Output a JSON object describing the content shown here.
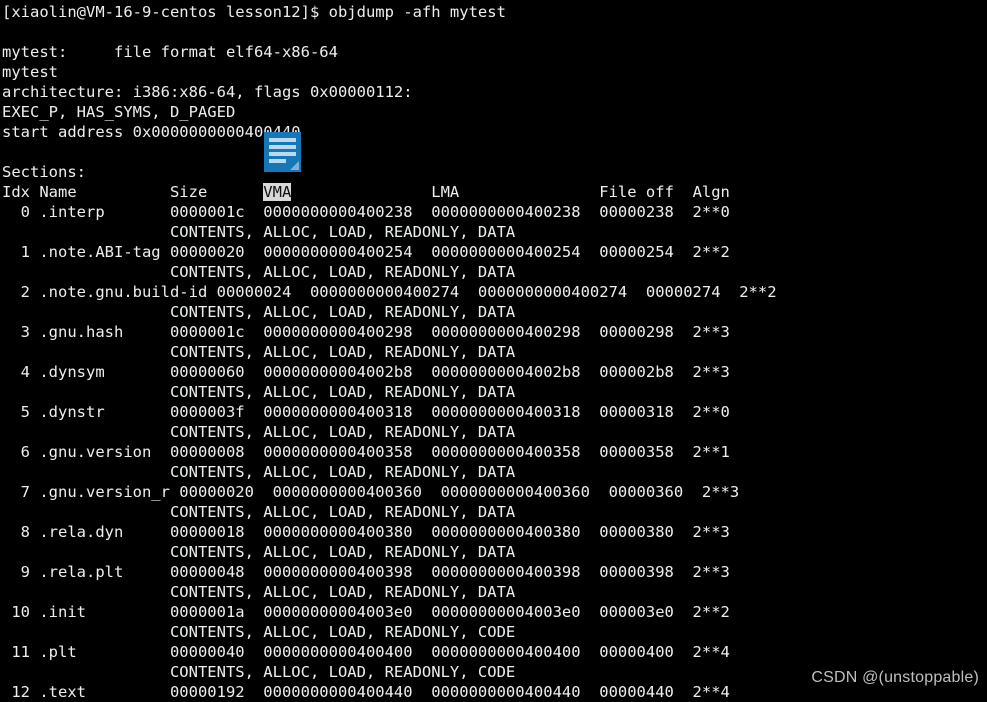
{
  "terminal": {
    "prompt": "[xiaolin@VM-16-9-centos lesson12]$ ",
    "command": "objdump -afh mytest",
    "prompt_line": "[xiaolin@VM-16-9-centos lesson12]$ objdump -afh mytest",
    "header": {
      "file_format_line": "mytest:     file format elf64-x86-64",
      "file_name_line": "mytest",
      "architecture_line": "architecture: i386:x86-64, flags 0x00000112:",
      "flags_line": "EXEC_P, HAS_SYMS, D_PAGED",
      "start_address_line": "start address 0x0000000000400440"
    },
    "sections_label": "Sections:",
    "columns": {
      "idx": "Idx",
      "name": "Name",
      "size": "Size",
      "vma": "VMA",
      "lma": "LMA",
      "file_off": "File off",
      "algn": "Algn",
      "header_line_pre": "Idx Name          Size      ",
      "header_line_sel": "VMA",
      "header_line_post": "               LMA               File off  Algn"
    },
    "sections": [
      {
        "line": "  0 .interp       0000001c  0000000000400238  0000000000400238  00000238  2**0",
        "flags": "                  CONTENTS, ALLOC, LOAD, READONLY, DATA",
        "idx": "0",
        "name": ".interp",
        "size": "0000001c",
        "vma": "0000000000400238",
        "lma": "0000000000400238",
        "file_off": "00000238",
        "algn": "2**0"
      },
      {
        "line": "  1 .note.ABI-tag 00000020  0000000000400254  0000000000400254  00000254  2**2",
        "flags": "                  CONTENTS, ALLOC, LOAD, READONLY, DATA",
        "idx": "1",
        "name": ".note.ABI-tag",
        "size": "00000020",
        "vma": "0000000000400254",
        "lma": "0000000000400254",
        "file_off": "00000254",
        "algn": "2**2"
      },
      {
        "line": "  2 .note.gnu.build-id 00000024  0000000000400274  0000000000400274  00000274  2**2",
        "flags": "                  CONTENTS, ALLOC, LOAD, READONLY, DATA",
        "idx": "2",
        "name": ".note.gnu.build-id",
        "size": "00000024",
        "vma": "0000000000400274",
        "lma": "0000000000400274",
        "file_off": "00000274",
        "algn": "2**2"
      },
      {
        "line": "  3 .gnu.hash     0000001c  0000000000400298  0000000000400298  00000298  2**3",
        "flags": "                  CONTENTS, ALLOC, LOAD, READONLY, DATA",
        "idx": "3",
        "name": ".gnu.hash",
        "size": "0000001c",
        "vma": "0000000000400298",
        "lma": "0000000000400298",
        "file_off": "00000298",
        "algn": "2**3"
      },
      {
        "line": "  4 .dynsym       00000060  00000000004002b8  00000000004002b8  000002b8  2**3",
        "flags": "                  CONTENTS, ALLOC, LOAD, READONLY, DATA",
        "idx": "4",
        "name": ".dynsym",
        "size": "00000060",
        "vma": "00000000004002b8",
        "lma": "00000000004002b8",
        "file_off": "000002b8",
        "algn": "2**3"
      },
      {
        "line": "  5 .dynstr       0000003f  0000000000400318  0000000000400318  00000318  2**0",
        "flags": "                  CONTENTS, ALLOC, LOAD, READONLY, DATA",
        "idx": "5",
        "name": ".dynstr",
        "size": "0000003f",
        "vma": "0000000000400318",
        "lma": "0000000000400318",
        "file_off": "00000318",
        "algn": "2**0"
      },
      {
        "line": "  6 .gnu.version  00000008  0000000000400358  0000000000400358  00000358  2**1",
        "flags": "                  CONTENTS, ALLOC, LOAD, READONLY, DATA",
        "idx": "6",
        "name": ".gnu.version",
        "size": "00000008",
        "vma": "0000000000400358",
        "lma": "0000000000400358",
        "file_off": "00000358",
        "algn": "2**1"
      },
      {
        "line": "  7 .gnu.version_r 00000020  0000000000400360  0000000000400360  00000360  2**3",
        "flags": "                  CONTENTS, ALLOC, LOAD, READONLY, DATA",
        "idx": "7",
        "name": ".gnu.version_r",
        "size": "00000020",
        "vma": "0000000000400360",
        "lma": "0000000000400360",
        "file_off": "00000360",
        "algn": "2**3"
      },
      {
        "line": "  8 .rela.dyn     00000018  0000000000400380  0000000000400380  00000380  2**3",
        "flags": "                  CONTENTS, ALLOC, LOAD, READONLY, DATA",
        "idx": "8",
        "name": ".rela.dyn",
        "size": "00000018",
        "vma": "0000000000400380",
        "lma": "0000000000400380",
        "file_off": "00000380",
        "algn": "2**3"
      },
      {
        "line": "  9 .rela.plt     00000048  0000000000400398  0000000000400398  00000398  2**3",
        "flags": "                  CONTENTS, ALLOC, LOAD, READONLY, DATA",
        "idx": "9",
        "name": ".rela.plt",
        "size": "00000048",
        "vma": "0000000000400398",
        "lma": "0000000000400398",
        "file_off": "00000398",
        "algn": "2**3"
      },
      {
        "line": " 10 .init         0000001a  00000000004003e0  00000000004003e0  000003e0  2**2",
        "flags": "                  CONTENTS, ALLOC, LOAD, READONLY, CODE",
        "idx": "10",
        "name": ".init",
        "size": "0000001a",
        "vma": "00000000004003e0",
        "lma": "00000000004003e0",
        "file_off": "000003e0",
        "algn": "2**2"
      },
      {
        "line": " 11 .plt          00000040  0000000000400400  0000000000400400  00000400  2**4",
        "flags": "                  CONTENTS, ALLOC, LOAD, READONLY, CODE",
        "idx": "11",
        "name": ".plt",
        "size": "00000040",
        "vma": "0000000000400400",
        "lma": "0000000000400400",
        "file_off": "00000400",
        "algn": "2**4"
      },
      {
        "line": " 12 .text         00000192  0000000000400440  0000000000400440  00000440  2**4",
        "flags": "",
        "idx": "12",
        "name": ".text",
        "size": "00000192",
        "vma": "0000000000400440",
        "lma": "0000000000400440",
        "file_off": "00000440",
        "algn": "2**4"
      }
    ]
  },
  "overlay": {
    "drag_icon_name": "document-drag-icon",
    "drag_icon_color": "#1577b7"
  },
  "watermark": {
    "text": "CSDN @(unstoppable)"
  },
  "colors": {
    "background": "#000000",
    "foreground": "#eceff1",
    "selection_bg": "#d8d8d8",
    "selection_fg": "#101010"
  }
}
